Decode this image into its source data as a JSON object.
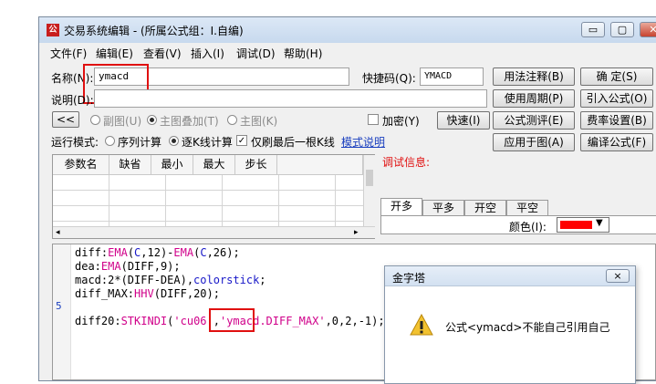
{
  "window": {
    "title": "交易系统编辑 - (所属公式组：I.自编)",
    "app_icon": "formula-app-icon"
  },
  "menu": [
    "文件(F)",
    "编辑(E)",
    "查看(V)",
    "插入(I)",
    "调试(D)",
    "帮助(H)"
  ],
  "form": {
    "name_label": "名称(N):",
    "name_value": "ymacd",
    "shortcut_label": "快捷码(Q):",
    "shortcut_value": "YMACD",
    "desc_label": "说明(D):",
    "desc_value": "",
    "collapse_button": "<<",
    "chart_mode": [
      "副图(U)",
      "主图叠加(T)",
      "主图(K)"
    ],
    "chart_mode_selected": 1,
    "encrypt_label": "加密(Y)",
    "quick_test_button": "快速(I)",
    "run_mode_label": "运行模式:",
    "run_mode": [
      "序列计算",
      "逐K线计算"
    ],
    "run_mode_selected": 1,
    "refresh_last_label": "仅刷最后一根K线",
    "refresh_last_checked": true,
    "mode_help_link": "模式说明"
  },
  "right_buttons": [
    [
      "用法注释(B)",
      "确  定(S)"
    ],
    [
      "使用周期(P)",
      "引入公式(O)"
    ],
    [
      "公式测评(E)",
      "费率设置(B)"
    ],
    [
      "应用于图(A)",
      "编译公式(F)"
    ]
  ],
  "param_table": {
    "headers": [
      "参数名",
      "缺省",
      "最小",
      "最大",
      "步长"
    ],
    "rows": 5
  },
  "debug": {
    "label": "调试信息:",
    "tabs": [
      "开多",
      "平多",
      "开空",
      "平空"
    ],
    "active_tab": 0,
    "color_label": "颜色(I):",
    "color_value": "#ff0000"
  },
  "code": {
    "gutter_number": "5",
    "lines": [
      "diff:EMA(C,12)-EMA(C,26);",
      "dea:EMA(DIFF,9);",
      "macd:2*(DIFF-DEA),colorstick;",
      "diff_MAX:HHV(DIFF,20);",
      "",
      "diff20:STKINDI('cu06','ymacd.DIFF_MAX',0,2,-1);"
    ]
  },
  "dialog": {
    "title": "金字塔",
    "message": "公式<ymacd>不能自己引用自己",
    "icon": "warning-icon",
    "close_label": "×"
  }
}
